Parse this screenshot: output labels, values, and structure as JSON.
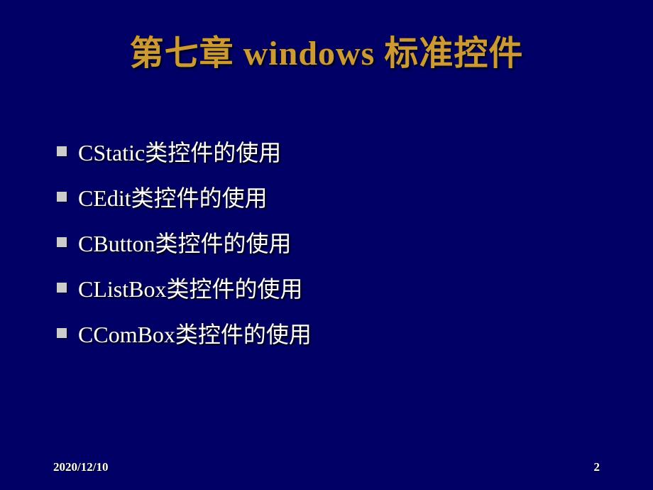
{
  "title": "第七章   windows 标准控件",
  "bullets": [
    "CStatic类控件的使用",
    "CEdit类控件的使用",
    "CButton类控件的使用",
    "CListBox类控件的使用",
    "CComBox类控件的使用"
  ],
  "footer": {
    "date": "2020/12/10",
    "page": "2"
  }
}
